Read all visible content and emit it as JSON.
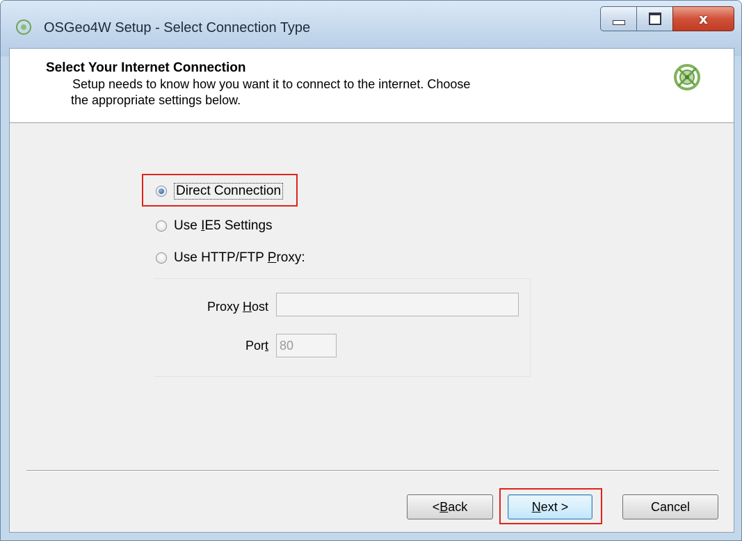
{
  "window": {
    "title": "OSGeo4W Setup - Select Connection Type",
    "controls": {
      "minimize": "minimize",
      "maximize": "maximize",
      "close": "x"
    }
  },
  "header": {
    "title": "Select Your Internet Connection",
    "description_line1": "Setup needs to know how you want it to connect to the internet.  Choose",
    "description_line2": "the appropriate settings below.",
    "logo_icon": "osgeo-logo-icon"
  },
  "options": {
    "direct": {
      "label": "Direct Connection",
      "checked": true
    },
    "ie5": {
      "label_pre": "Use ",
      "label_mnemonic": "I",
      "label_post": "E5 Settings",
      "checked": false
    },
    "proxy": {
      "label_pre": "Use HTTP/FTP ",
      "label_mnemonic": "P",
      "label_post": "roxy:",
      "checked": false
    }
  },
  "proxy_settings": {
    "host_label_pre": "Proxy ",
    "host_label_mnemonic": "H",
    "host_label_post": "ost",
    "host_value": "",
    "port_label_pre": "Por",
    "port_label_mnemonic": "t",
    "port_value": "80"
  },
  "buttons": {
    "back_pre": "< ",
    "back_mnemonic": "B",
    "back_post": "ack",
    "next_mnemonic": "N",
    "next_post": "ext >",
    "cancel": "Cancel"
  },
  "colors": {
    "highlight": "#e0231a",
    "title_bar": "#c2d6eb",
    "close_button": "#d0513a"
  }
}
